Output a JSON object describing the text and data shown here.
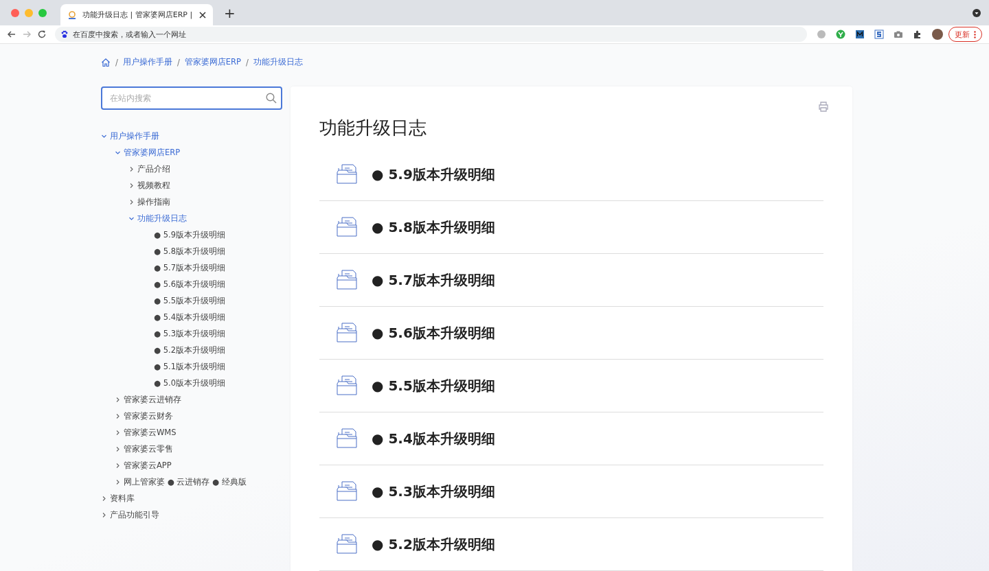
{
  "browser": {
    "tab_title": "功能升级日志 | 管家婆网店ERP |",
    "new_tab": "+",
    "address_placeholder": "在百度中搜索，或者输入一个网址",
    "update_button": "更新"
  },
  "breadcrumb": {
    "separator": "/",
    "items": [
      "用户操作手册",
      "管家婆网店ERP",
      "功能升级日志"
    ]
  },
  "search": {
    "placeholder": "在站内搜索"
  },
  "sidebar": {
    "items": [
      {
        "label": "用户操作手册",
        "kind": "folder",
        "expanded": true,
        "active": true,
        "children": [
          {
            "label": "管家婆网店ERP",
            "kind": "folder",
            "expanded": true,
            "active": true,
            "children": [
              {
                "label": "产品介绍",
                "kind": "folder",
                "expanded": false,
                "active": false
              },
              {
                "label": "视频教程",
                "kind": "folder",
                "expanded": false,
                "active": false
              },
              {
                "label": "操作指南",
                "kind": "folder",
                "expanded": false,
                "active": false
              },
              {
                "label": "功能升级日志",
                "kind": "folder",
                "expanded": true,
                "active": true,
                "children": [
                  {
                    "label": "● 5.9版本升级明细",
                    "kind": "page",
                    "active": false
                  },
                  {
                    "label": "● 5.8版本升级明细",
                    "kind": "page",
                    "active": false
                  },
                  {
                    "label": "● 5.7版本升级明细",
                    "kind": "page",
                    "active": false
                  },
                  {
                    "label": "● 5.6版本升级明细",
                    "kind": "page",
                    "active": false
                  },
                  {
                    "label": "● 5.5版本升级明细",
                    "kind": "page",
                    "active": false
                  },
                  {
                    "label": "● 5.4版本升级明细",
                    "kind": "page",
                    "active": false
                  },
                  {
                    "label": "● 5.3版本升级明细",
                    "kind": "page",
                    "active": false
                  },
                  {
                    "label": "● 5.2版本升级明细",
                    "kind": "page",
                    "active": false
                  },
                  {
                    "label": "● 5.1版本升级明细",
                    "kind": "page",
                    "active": false
                  },
                  {
                    "label": "● 5.0版本升级明细",
                    "kind": "page",
                    "active": false
                  }
                ]
              }
            ]
          },
          {
            "label": "管家婆云进销存",
            "kind": "folder",
            "expanded": false,
            "active": false
          },
          {
            "label": "管家婆云财务",
            "kind": "folder",
            "expanded": false,
            "active": false
          },
          {
            "label": "管家婆云WMS",
            "kind": "folder",
            "expanded": false,
            "active": false
          },
          {
            "label": "管家婆云零售",
            "kind": "folder",
            "expanded": false,
            "active": false
          },
          {
            "label": "管家婆云APP",
            "kind": "folder",
            "expanded": false,
            "active": false
          },
          {
            "label": "网上管家婆 ● 云进销存 ● 经典版",
            "kind": "folder",
            "expanded": false,
            "active": false
          }
        ]
      },
      {
        "label": "资料库",
        "kind": "folder",
        "expanded": false,
        "active": false
      },
      {
        "label": "产品功能引导",
        "kind": "folder",
        "expanded": false,
        "active": false
      }
    ]
  },
  "article": {
    "title": "功能升级日志",
    "entries": [
      "● 5.9版本升级明细",
      "● 5.8版本升级明细",
      "● 5.7版本升级明细",
      "● 5.6版本升级明细",
      "● 5.5版本升级明细",
      "● 5.4版本升级明细",
      "● 5.3版本升级明细",
      "● 5.2版本升级明细"
    ]
  }
}
